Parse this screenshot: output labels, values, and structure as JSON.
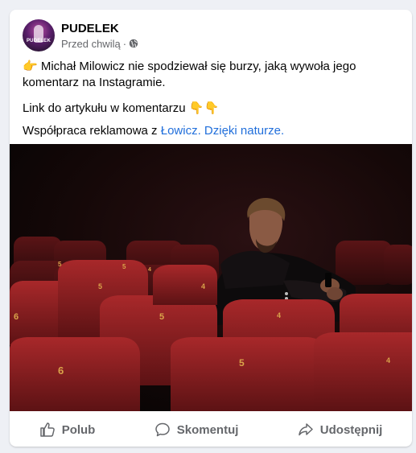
{
  "post": {
    "page_name": "PUDELEK",
    "avatar_text": "PUDELEK",
    "time": "Przed chwilą",
    "separator": "·",
    "privacy_icon": "globe-icon",
    "line1_emoji": "👉",
    "line1_text": "Michał Milowicz nie spodziewał się burzy, jaką wywoła jego komentarz na Instagramie.",
    "line2_text": "Link do artykułu w komentarzu",
    "line2_emoji": "👇👇",
    "line3_text": "Współpraca reklamowa z",
    "line3_link": "Łowicz. Dzięki naturze.",
    "image_icon": "man-in-cinema-seats-photo"
  },
  "actions": {
    "like_label": "Polub",
    "comment_label": "Skomentuj",
    "share_label": "Udostępnij"
  },
  "colors": {
    "link": "#216fdb",
    "secondary_text": "#65676b",
    "seat_red": "#8c1d1f",
    "seat_number": "#d9a34a"
  }
}
